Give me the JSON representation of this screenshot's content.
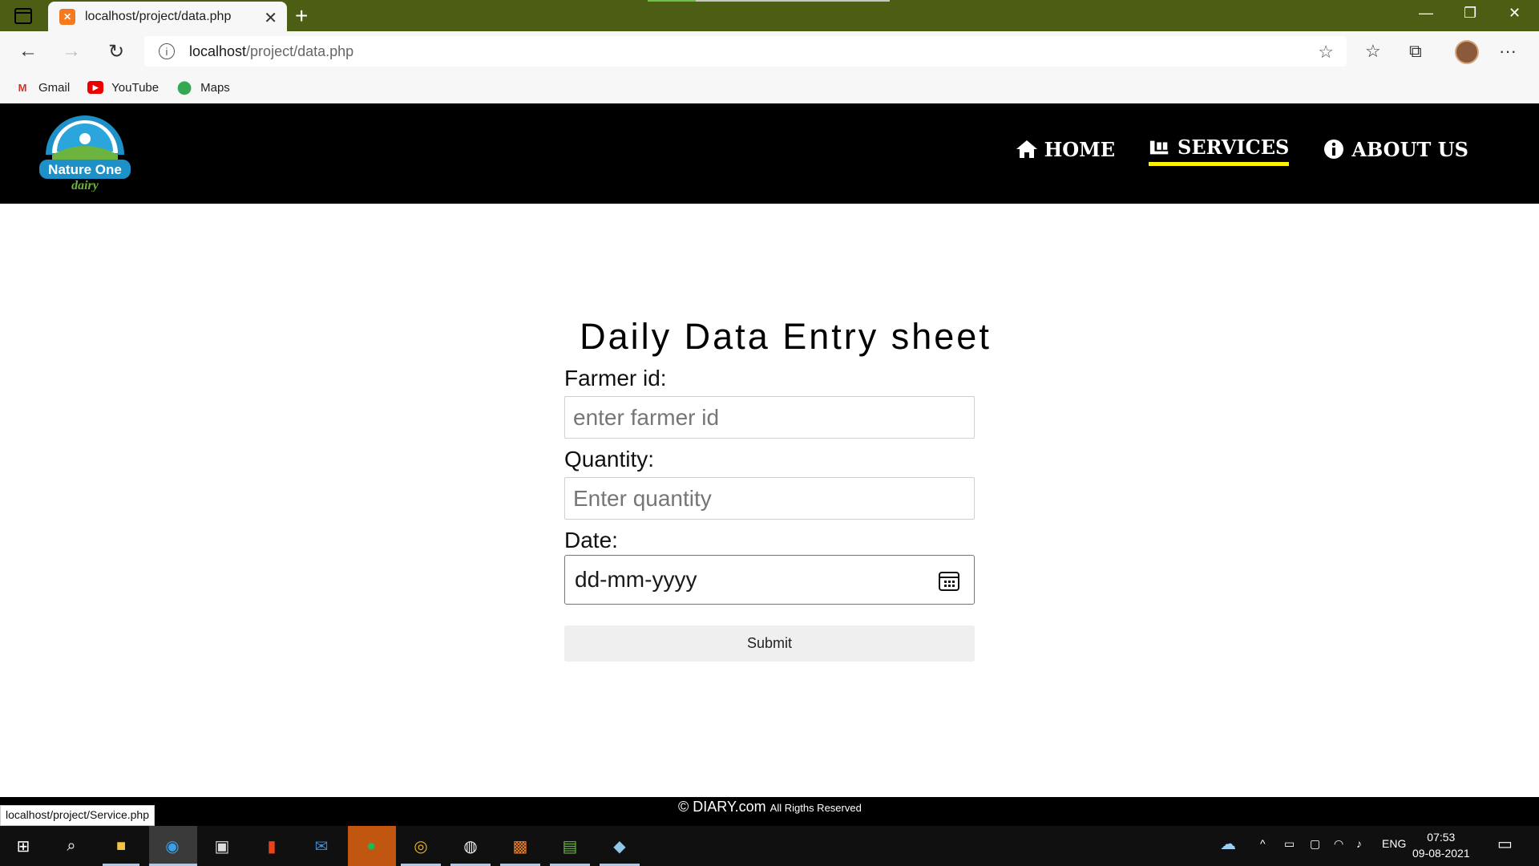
{
  "browser": {
    "tab_title": "localhost/project/data.php",
    "url_host": "localhost",
    "url_path": "/project/data.php",
    "bookmarks": [
      {
        "label": "Gmail",
        "icon": "gmail-icon"
      },
      {
        "label": "YouTube",
        "icon": "youtube-icon"
      },
      {
        "label": "Maps",
        "icon": "maps-icon"
      }
    ],
    "status_url": "localhost/project/Service.php"
  },
  "site": {
    "logo_text_1": "Nature One",
    "logo_text_2": "dairy",
    "nav": {
      "home": "HOME",
      "services": "SERVICES",
      "about": "ABOUT US"
    }
  },
  "form": {
    "title": "Daily Data Entry sheet",
    "farmer_label": "Farmer id:",
    "farmer_placeholder": "enter farmer id",
    "quantity_label": "Quantity:",
    "quantity_placeholder": "Enter quantity",
    "date_label": "Date:",
    "date_value": "dd-mm-yyyy",
    "submit_label": "Submit"
  },
  "footer": {
    "brand": "© DIARY.com",
    "rights": "All Rigths Reserved"
  },
  "taskbar": {
    "language": "ENG",
    "time": "07:53",
    "date": "09-08-2021"
  },
  "colors": {
    "titlebar": "#4b5e14",
    "header_bg": "#000000",
    "nav_active_underline": "#fff200"
  }
}
